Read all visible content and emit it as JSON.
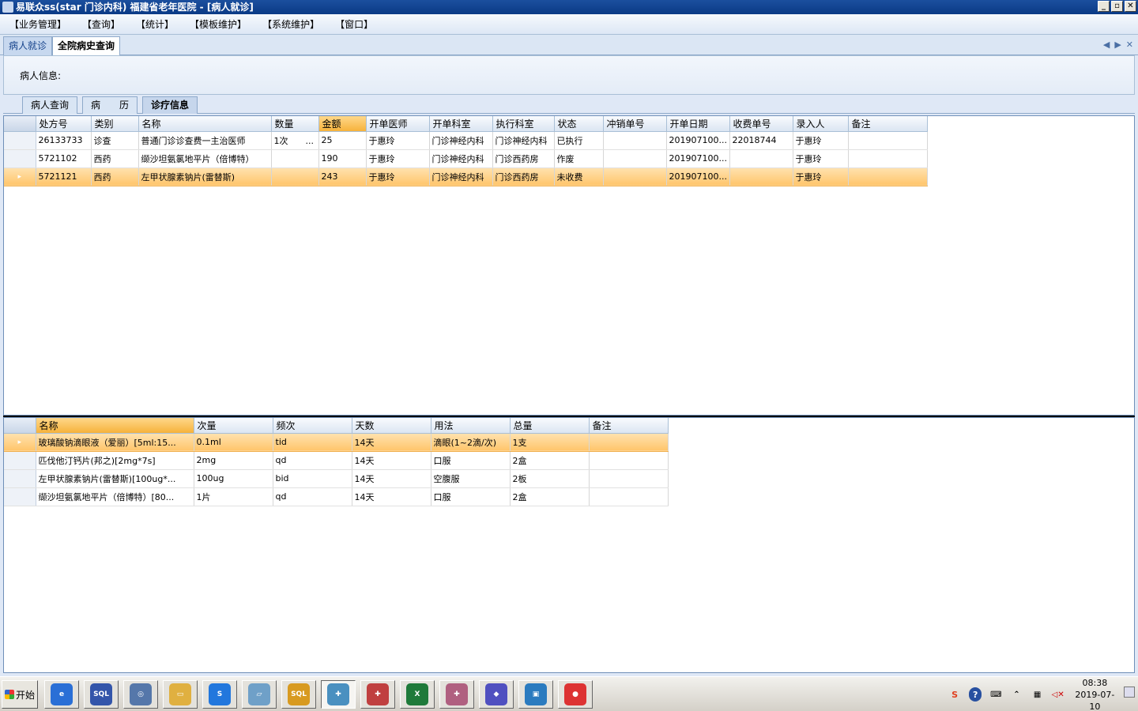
{
  "window": {
    "title": "易联众ss(star 门诊内科) 福建省老年医院 - [病人就诊]",
    "buttons": [
      "_",
      "▫",
      "✕"
    ]
  },
  "menu": [
    "【业务管理】",
    "【查询】",
    "【统计】",
    "【模板维护】",
    "【系统维护】",
    "【窗口】"
  ],
  "doc_tabs": [
    {
      "label": "病人就诊"
    },
    {
      "label": "全院病史查询"
    }
  ],
  "patient": {
    "label": "病人信息:"
  },
  "sub_tabs": [
    {
      "label": "病人查询"
    },
    {
      "label": "病　　历"
    },
    {
      "label": "诊疗信息"
    }
  ],
  "orders_grid": {
    "columns": [
      "处方号",
      "类别",
      "名称",
      "数量",
      "金额",
      "开单医师",
      "开单科室",
      "执行科室",
      "状态",
      "冲销单号",
      "开单日期",
      "收费单号",
      "录入人",
      "备注"
    ],
    "rows": [
      [
        "26133733",
        "诊查",
        "普通门诊诊查费一主治医师",
        "1次　　...",
        "25",
        "于惠玲",
        "门诊神经内科",
        "门诊神经内科",
        "已执行",
        "",
        "201907100...",
        "22018744",
        "于惠玲",
        ""
      ],
      [
        "5721102",
        "西药",
        "缬沙坦氨氯地平片（倍博特）",
        "",
        "190",
        "于惠玲",
        "门诊神经内科",
        "门诊西药房",
        "作废",
        "",
        "201907100...",
        "",
        "于惠玲",
        ""
      ],
      [
        "5721121",
        "西药",
        "左甲状腺素钠片(雷替斯)",
        "",
        "243",
        "于惠玲",
        "门诊神经内科",
        "门诊西药房",
        "未收费",
        "",
        "201907100...",
        "",
        "于惠玲",
        ""
      ]
    ]
  },
  "detail_grid": {
    "columns": [
      "名称",
      "次量",
      "频次",
      "天数",
      "用法",
      "总量",
      "备注"
    ],
    "rows": [
      [
        "玻璃酸钠滴眼液（爱丽）[5ml:15...",
        "0.1ml",
        "tid",
        "14天",
        "滴眼(1~2滴/次)",
        "1支",
        ""
      ],
      [
        "匹伐他汀钙片(邦之)[2mg*7s]",
        "2mg",
        "qd",
        "14天",
        "口服",
        "2盒",
        ""
      ],
      [
        "左甲状腺素钠片(雷替斯)[100ug*...",
        "100ug",
        "bid",
        "14天",
        "空腹服",
        "2板",
        ""
      ],
      [
        "缬沙坦氨氯地平片（倍博特）[80...",
        "1片",
        "qd",
        "14天",
        "口服",
        "2盒",
        ""
      ]
    ]
  },
  "taskbar": {
    "start_label": "开始",
    "apps": [
      {
        "name": "ie-icon",
        "color": "#2a6fd6",
        "glyph": "e"
      },
      {
        "name": "sql-query-icon",
        "color": "#3355aa",
        "glyph": "SQL"
      },
      {
        "name": "compass-icon",
        "color": "#5577aa",
        "glyph": "◎"
      },
      {
        "name": "folder-icon",
        "color": "#e0b040",
        "glyph": "▭"
      },
      {
        "name": "sogou-icon",
        "color": "#2277dd",
        "glyph": "S"
      },
      {
        "name": "notebook-icon",
        "color": "#6fa0c8",
        "glyph": "▱"
      },
      {
        "name": "sql-server-icon",
        "color": "#d89a20",
        "glyph": "SQL"
      },
      {
        "name": "doctor-icon",
        "color": "#4a90c0",
        "glyph": "✚"
      },
      {
        "name": "nurse-icon",
        "color": "#c04040",
        "glyph": "✚"
      },
      {
        "name": "excel-icon",
        "color": "#1f7a3a",
        "glyph": "X"
      },
      {
        "name": "medical-staff-icon",
        "color": "#b06080",
        "glyph": "✚"
      },
      {
        "name": "diamond-app-icon",
        "color": "#5050c0",
        "glyph": "◆"
      },
      {
        "name": "remote-desktop-icon",
        "color": "#2b7bbf",
        "glyph": "▣"
      },
      {
        "name": "chrome-icon",
        "color": "#d33",
        "glyph": "●"
      }
    ],
    "clock": {
      "time": "08:38",
      "date": "2019-07-10"
    }
  }
}
